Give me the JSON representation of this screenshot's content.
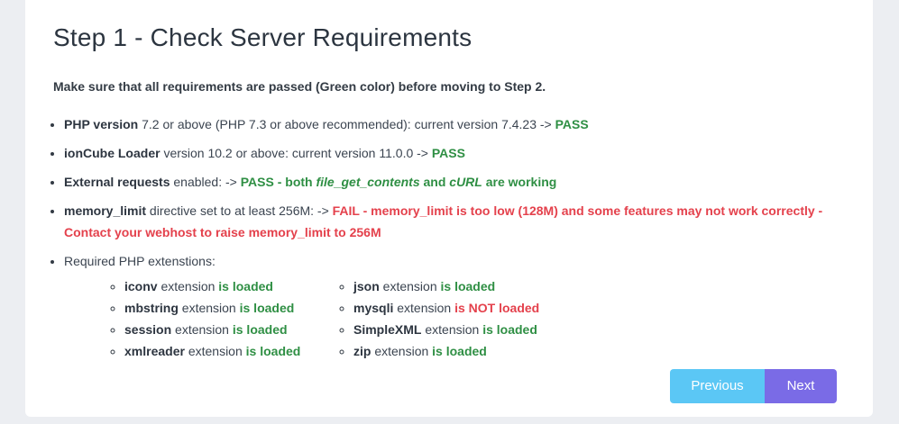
{
  "title": "Step 1 - Check Server Requirements",
  "intro": "Make sure that all requirements are passed (Green color) before moving to Step 2.",
  "requirements": {
    "php": {
      "name": "PHP version",
      "text": " 7.2 or above (PHP 7.3 or above recommended): current version 7.4.23 -> ",
      "status": "PASS"
    },
    "ioncube": {
      "name": "ionCube Loader",
      "text": " version 10.2 or above: current version 11.0.0 -> ",
      "status": "PASS"
    },
    "external": {
      "name": "External requests",
      "text": " enabled: -> ",
      "status_a": "PASS - both ",
      "func1": "file_get_contents",
      "and": " and ",
      "func2": "cURL",
      "status_b": " are working"
    },
    "memory": {
      "name": "memory_limit",
      "text": " directive set to at least 256M: -> ",
      "status": "FAIL - memory_limit is too low (128M) and some features may not work correctly - Contact your webhost to raise memory_limit to 256M"
    },
    "extensions_label": "Required PHP extenstions:"
  },
  "extensions": {
    "suffix": " extension ",
    "left": [
      {
        "name": "iconv",
        "status": "is loaded"
      },
      {
        "name": "mbstring",
        "status": "is loaded"
      },
      {
        "name": "session",
        "status": "is loaded"
      },
      {
        "name": "xmlreader",
        "status": "is loaded"
      }
    ],
    "right": [
      {
        "name": "json",
        "status": "is loaded"
      },
      {
        "name": "mysqli",
        "status": "is NOT loaded"
      },
      {
        "name": "SimpleXML",
        "status": "is loaded"
      },
      {
        "name": "zip",
        "status": "is loaded"
      }
    ]
  },
  "buttons": {
    "previous": "Previous",
    "next": "Next"
  },
  "colors": {
    "pass": "#2f8f44",
    "fail": "#e4414c",
    "previous_bg": "#5bc7f5",
    "next_bg": "#7a6be6"
  }
}
